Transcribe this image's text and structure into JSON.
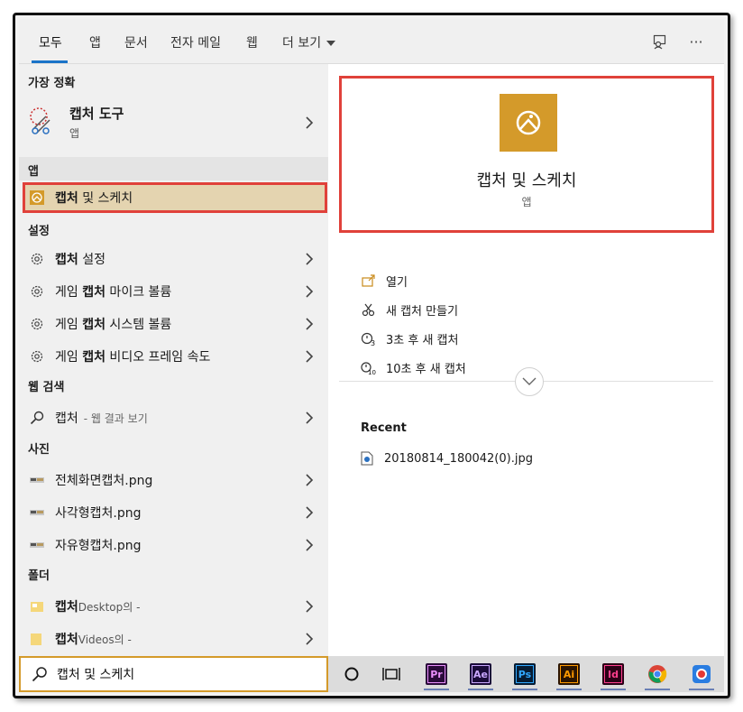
{
  "tabs": [
    {
      "label": "모두",
      "active": true
    },
    {
      "label": "앱"
    },
    {
      "label": "문서"
    },
    {
      "label": "전자 메일"
    },
    {
      "label": "웹"
    },
    {
      "label": "더 보기"
    }
  ],
  "top_icons": [
    "feedback-icon",
    "more-icon"
  ],
  "more_glyph": "···",
  "left": {
    "best_match": {
      "header": "가장 정확",
      "title": "캡처 도구",
      "type": "앱"
    },
    "apps": {
      "header": "앱",
      "items": [
        {
          "bold": "캡처",
          "rest": " 및 스케치"
        }
      ]
    },
    "settings": {
      "header": "설정",
      "items": [
        {
          "pre": "",
          "bold": "캡처",
          "rest": " 설정"
        },
        {
          "pre": "게임 ",
          "bold": "캡처",
          "rest": " 마이크 볼륨"
        },
        {
          "pre": "게임 ",
          "bold": "캡처",
          "rest": " 시스템 볼륨"
        },
        {
          "pre": "게임 ",
          "bold": "캡처",
          "rest": " 비디오 프레임 속도"
        }
      ]
    },
    "web": {
      "header": "웹 검색",
      "items": [
        {
          "label": "캡처",
          "sub": "- 웹 결과 보기"
        }
      ]
    },
    "photos": {
      "header": "사진",
      "items": [
        {
          "label": "전체화면캡처.png"
        },
        {
          "label": "사각형캡처.png"
        },
        {
          "label": "자유형캡처.png"
        }
      ]
    },
    "folders": {
      "header": "폴더",
      "items": [
        {
          "bold": "캡처",
          "rest": "Desktop의 -"
        },
        {
          "bold": "캡처",
          "rest": "Videos의 -"
        }
      ]
    }
  },
  "right": {
    "hero": {
      "title": "캡처 및 스케치",
      "type": "앱"
    },
    "actions": [
      {
        "label": "열기",
        "icon": "open-icon"
      },
      {
        "label": "새 캡처 만들기",
        "icon": "snip-icon"
      },
      {
        "label": "3초 후 새 캡처",
        "icon": "timer-3-icon",
        "badge": "3"
      },
      {
        "label": "10초 후 새 캡처",
        "icon": "timer-10-icon",
        "badge": "10"
      }
    ],
    "recent": {
      "title": "Recent",
      "items": [
        {
          "label": "20180814_180042(0).jpg"
        }
      ]
    }
  },
  "search": {
    "value": "캡처 및 스케치"
  },
  "taskbar": [
    {
      "name": "cortana-icon"
    },
    {
      "name": "task-view-icon"
    },
    {
      "name": "premiere-icon",
      "text": "Pr",
      "bg": "#2a0a3a",
      "fg": "#e98ffc"
    },
    {
      "name": "after-effects-icon",
      "text": "Ae",
      "bg": "#1a0b3a",
      "fg": "#c9a7ff"
    },
    {
      "name": "photoshop-icon",
      "text": "Ps",
      "bg": "#061c33",
      "fg": "#31a8ff"
    },
    {
      "name": "illustrator-icon",
      "text": "Ai",
      "bg": "#2b1400",
      "fg": "#ff9a00"
    },
    {
      "name": "indesign-icon",
      "text": "Id",
      "bg": "#2b0016",
      "fg": "#ff3f8e"
    },
    {
      "name": "chrome-icon"
    },
    {
      "name": "recorder-icon"
    }
  ],
  "colors": {
    "accent": "#1a73c8",
    "highlight": "#e0413a",
    "tile": "#d49a2a"
  }
}
